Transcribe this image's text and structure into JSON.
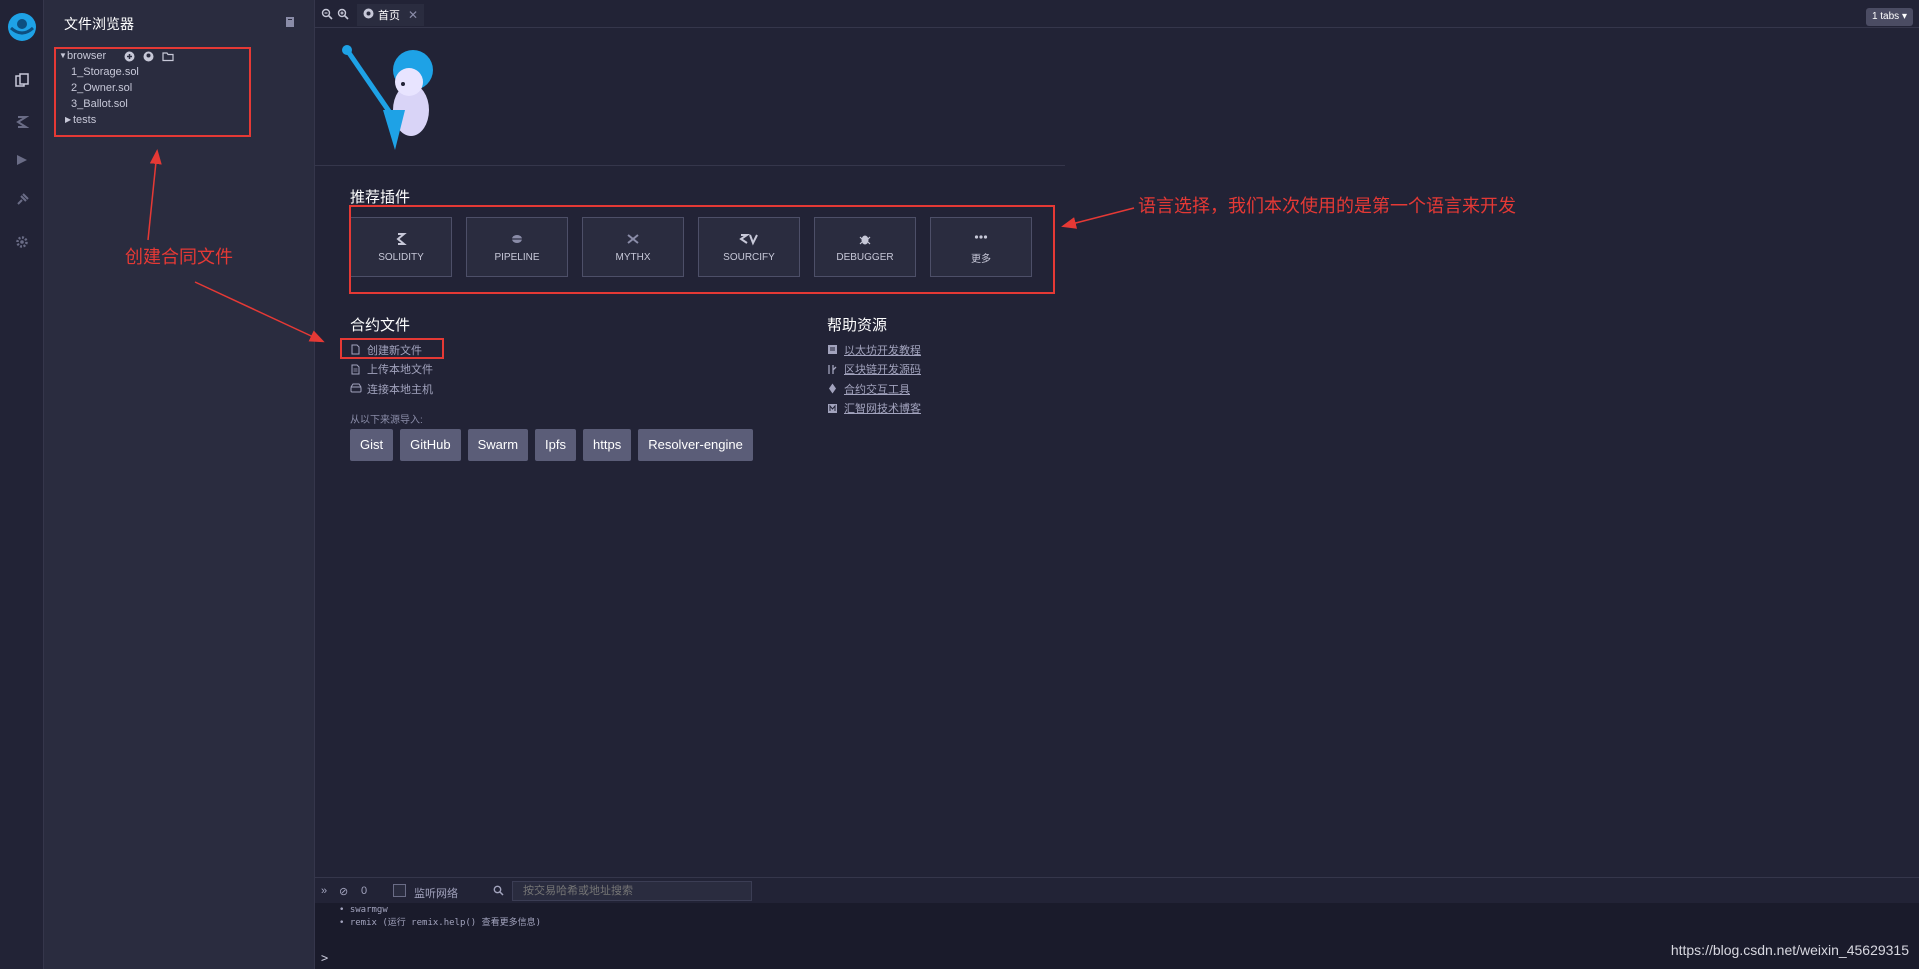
{
  "sidebar": {
    "title": "文件浏览器",
    "workspace": "browser",
    "files": [
      "1_Storage.sol",
      "2_Owner.sol",
      "3_Ballot.sol"
    ],
    "folder": "tests"
  },
  "tabbar": {
    "tab_label": "首页",
    "tabs_count": "1 tabs"
  },
  "home": {
    "plugins_title": "推荐插件",
    "plugins": [
      "SOLIDITY",
      "PIPELINE",
      "MYTHX",
      "SOURCIFY",
      "DEBUGGER",
      "更多"
    ],
    "files_title": "合约文件",
    "file_links": [
      "创建新文件",
      "上传本地文件",
      "连接本地主机"
    ],
    "help_title": "帮助资源",
    "help_links": [
      "以太坊开发教程",
      "区块链开发源码",
      "合约交互工具",
      "汇智网技术博客"
    ],
    "import_label": "从以下来源导入:",
    "import_sources": [
      "Gist",
      "GitHub",
      "Swarm",
      "Ipfs",
      "https",
      "Resolver-engine"
    ]
  },
  "terminal": {
    "count": "0",
    "listen_label": "监听网络",
    "search_placeholder": "按交易哈希或地址搜索",
    "lines": [
      "• swarmgw",
      "• remix (运行 remix.help() 查看更多信息)"
    ],
    "prompt": ">"
  },
  "annotations": {
    "create_contract": "创建合同文件",
    "language_select": "语言选择，我们本次使用的是第一个语言来开发"
  },
  "watermark": "https://blog.csdn.net/weixin_45629315",
  "colors": {
    "background": "#222336",
    "panel": "#2a2c3f",
    "annotation": "#e53935",
    "accent": "#1ea2e6"
  }
}
